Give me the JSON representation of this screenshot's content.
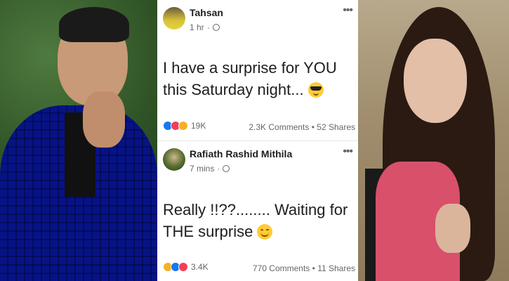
{
  "post1": {
    "author": "Tahsan",
    "time": "1 hr",
    "text": "I have a surprise for YOU this Saturday night...",
    "emoji": "sunglasses-emoji",
    "reaction_count": "19K",
    "comments": "2.3K Comments",
    "shares": "52 Shares",
    "reactions": [
      "like",
      "love",
      "wow"
    ]
  },
  "post2": {
    "author": "Rafiath Rashid Mithila",
    "time": "7 mins",
    "text": "Really !!??........ Waiting for THE surprise",
    "emoji": "smiling-emoji",
    "reaction_count": "3.4K",
    "comments": "770 Comments",
    "shares": "11 Shares",
    "reactions": [
      "haha",
      "like",
      "love"
    ]
  },
  "colors": {
    "like": "#1877f2",
    "love": "#f33e58",
    "wow": "#f7b125",
    "secondary_text": "#65676b",
    "primary_text": "#1c1e21"
  }
}
